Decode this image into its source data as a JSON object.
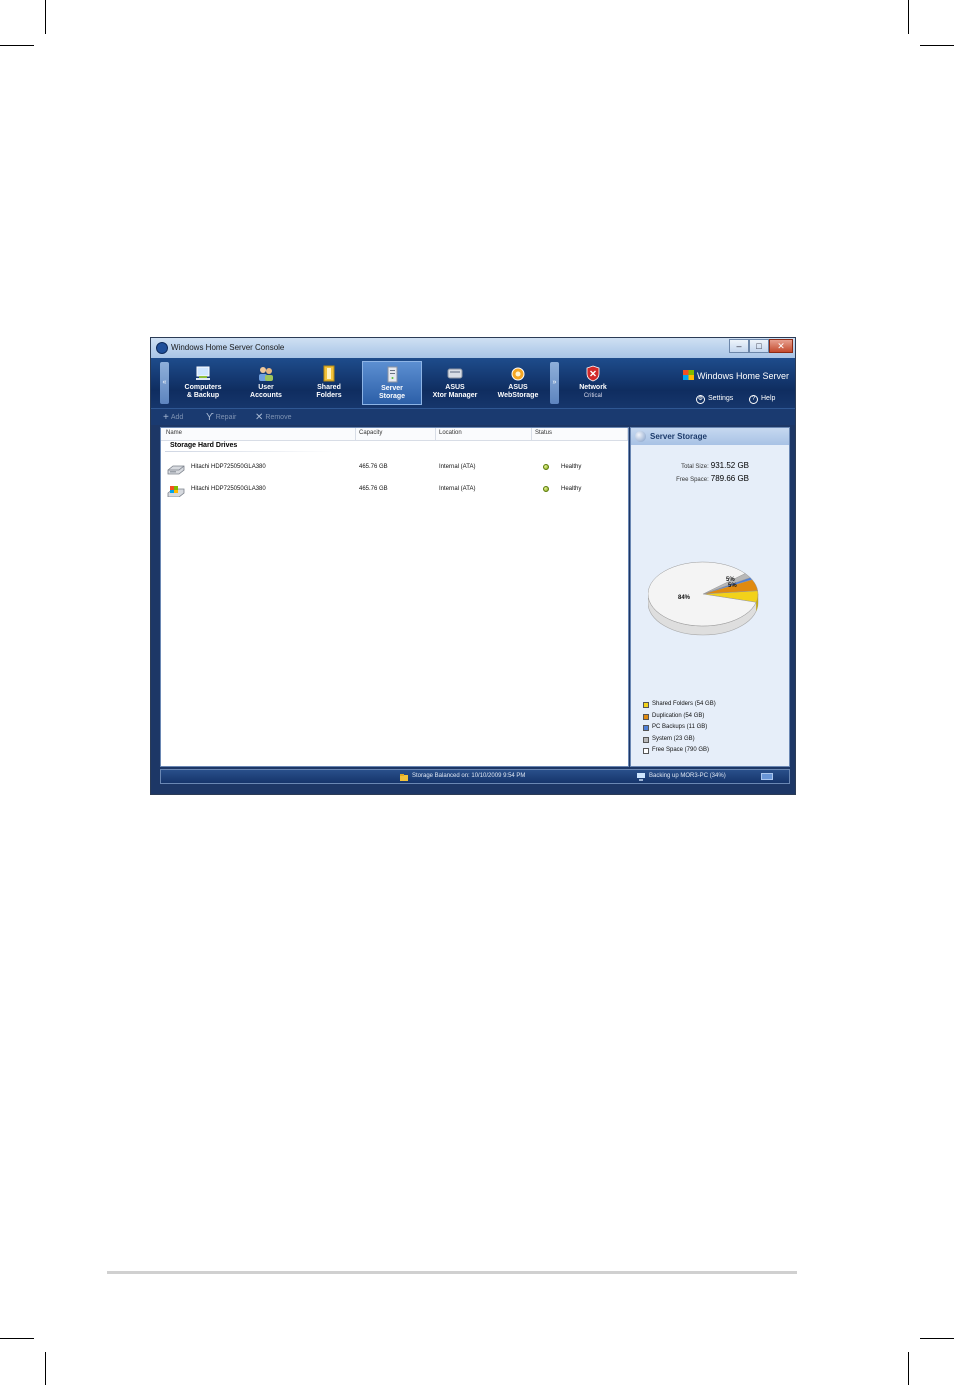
{
  "window": {
    "title": "Windows Home Server Console",
    "buttons": {
      "minimize": "–",
      "maximize": "□",
      "close": "✕"
    }
  },
  "nav": {
    "scroll_left": "«",
    "scroll_right": "»",
    "tabs": [
      {
        "label": "Computers\n& Backup",
        "icon": "computers-icon"
      },
      {
        "label": "User\nAccounts",
        "icon": "users-icon"
      },
      {
        "label": "Shared\nFolders",
        "icon": "folders-icon"
      },
      {
        "label": "Server\nStorage",
        "icon": "server-icon",
        "active": true
      },
      {
        "label": "ASUS\nXtor Manager",
        "icon": "xtor-icon"
      },
      {
        "label": "ASUS\nWebStorage",
        "icon": "webstorage-icon"
      }
    ],
    "network": {
      "label": "Network",
      "status": "Critical"
    },
    "brand": "Windows Home Server",
    "settings": "Settings",
    "help": "Help"
  },
  "toolbar": {
    "add": "Add",
    "repair": "Repair",
    "remove": "Remove"
  },
  "table": {
    "columns": [
      "Name",
      "Capacity",
      "Location",
      "Status"
    ],
    "group": "Storage Hard Drives",
    "rows": [
      {
        "name": "Hitachi HDP725050GLA380",
        "capacity": "465.76 GB",
        "location": "Internal (ATA)",
        "status": "Healthy"
      },
      {
        "name": "Hitachi HDP725050GLA380",
        "capacity": "465.76 GB",
        "location": "Internal (ATA)",
        "status": "Healthy"
      }
    ]
  },
  "side": {
    "title": "Server Storage",
    "total_label": "Total Size:",
    "total_value": "931.52 GB",
    "free_label": "Free Space:",
    "free_value": "789.66 GB",
    "legend": [
      {
        "label": "Shared Folders (54 GB)",
        "color": "#f2d21a"
      },
      {
        "label": "Duplication (54 GB)",
        "color": "#e08a10"
      },
      {
        "label": "PC Backups (11 GB)",
        "color": "#4f7fd6"
      },
      {
        "label": "System (23 GB)",
        "color": "#b8b8b8"
      },
      {
        "label": "Free Space (790 GB)",
        "color": "#ffffff"
      }
    ]
  },
  "chart_data": {
    "type": "pie",
    "slices": [
      {
        "label": "Shared Folders",
        "value": 54,
        "color": "#f2d21a"
      },
      {
        "label": "Duplication",
        "value": 54,
        "color": "#e08a10"
      },
      {
        "label": "PC Backups",
        "value": 11,
        "color": "#4f7fd6"
      },
      {
        "label": "System",
        "value": 23,
        "color": "#b8b8b8"
      },
      {
        "label": "Free Space",
        "value": 790,
        "color": "#f4f4f4"
      }
    ],
    "data_labels": [
      "84%",
      "5%",
      "5%"
    ]
  },
  "status_bar": {
    "balanced": "Storage Balanced on: 10/10/2009 9:54 PM",
    "backup": "Backing up MOR3-PC (34%)"
  }
}
